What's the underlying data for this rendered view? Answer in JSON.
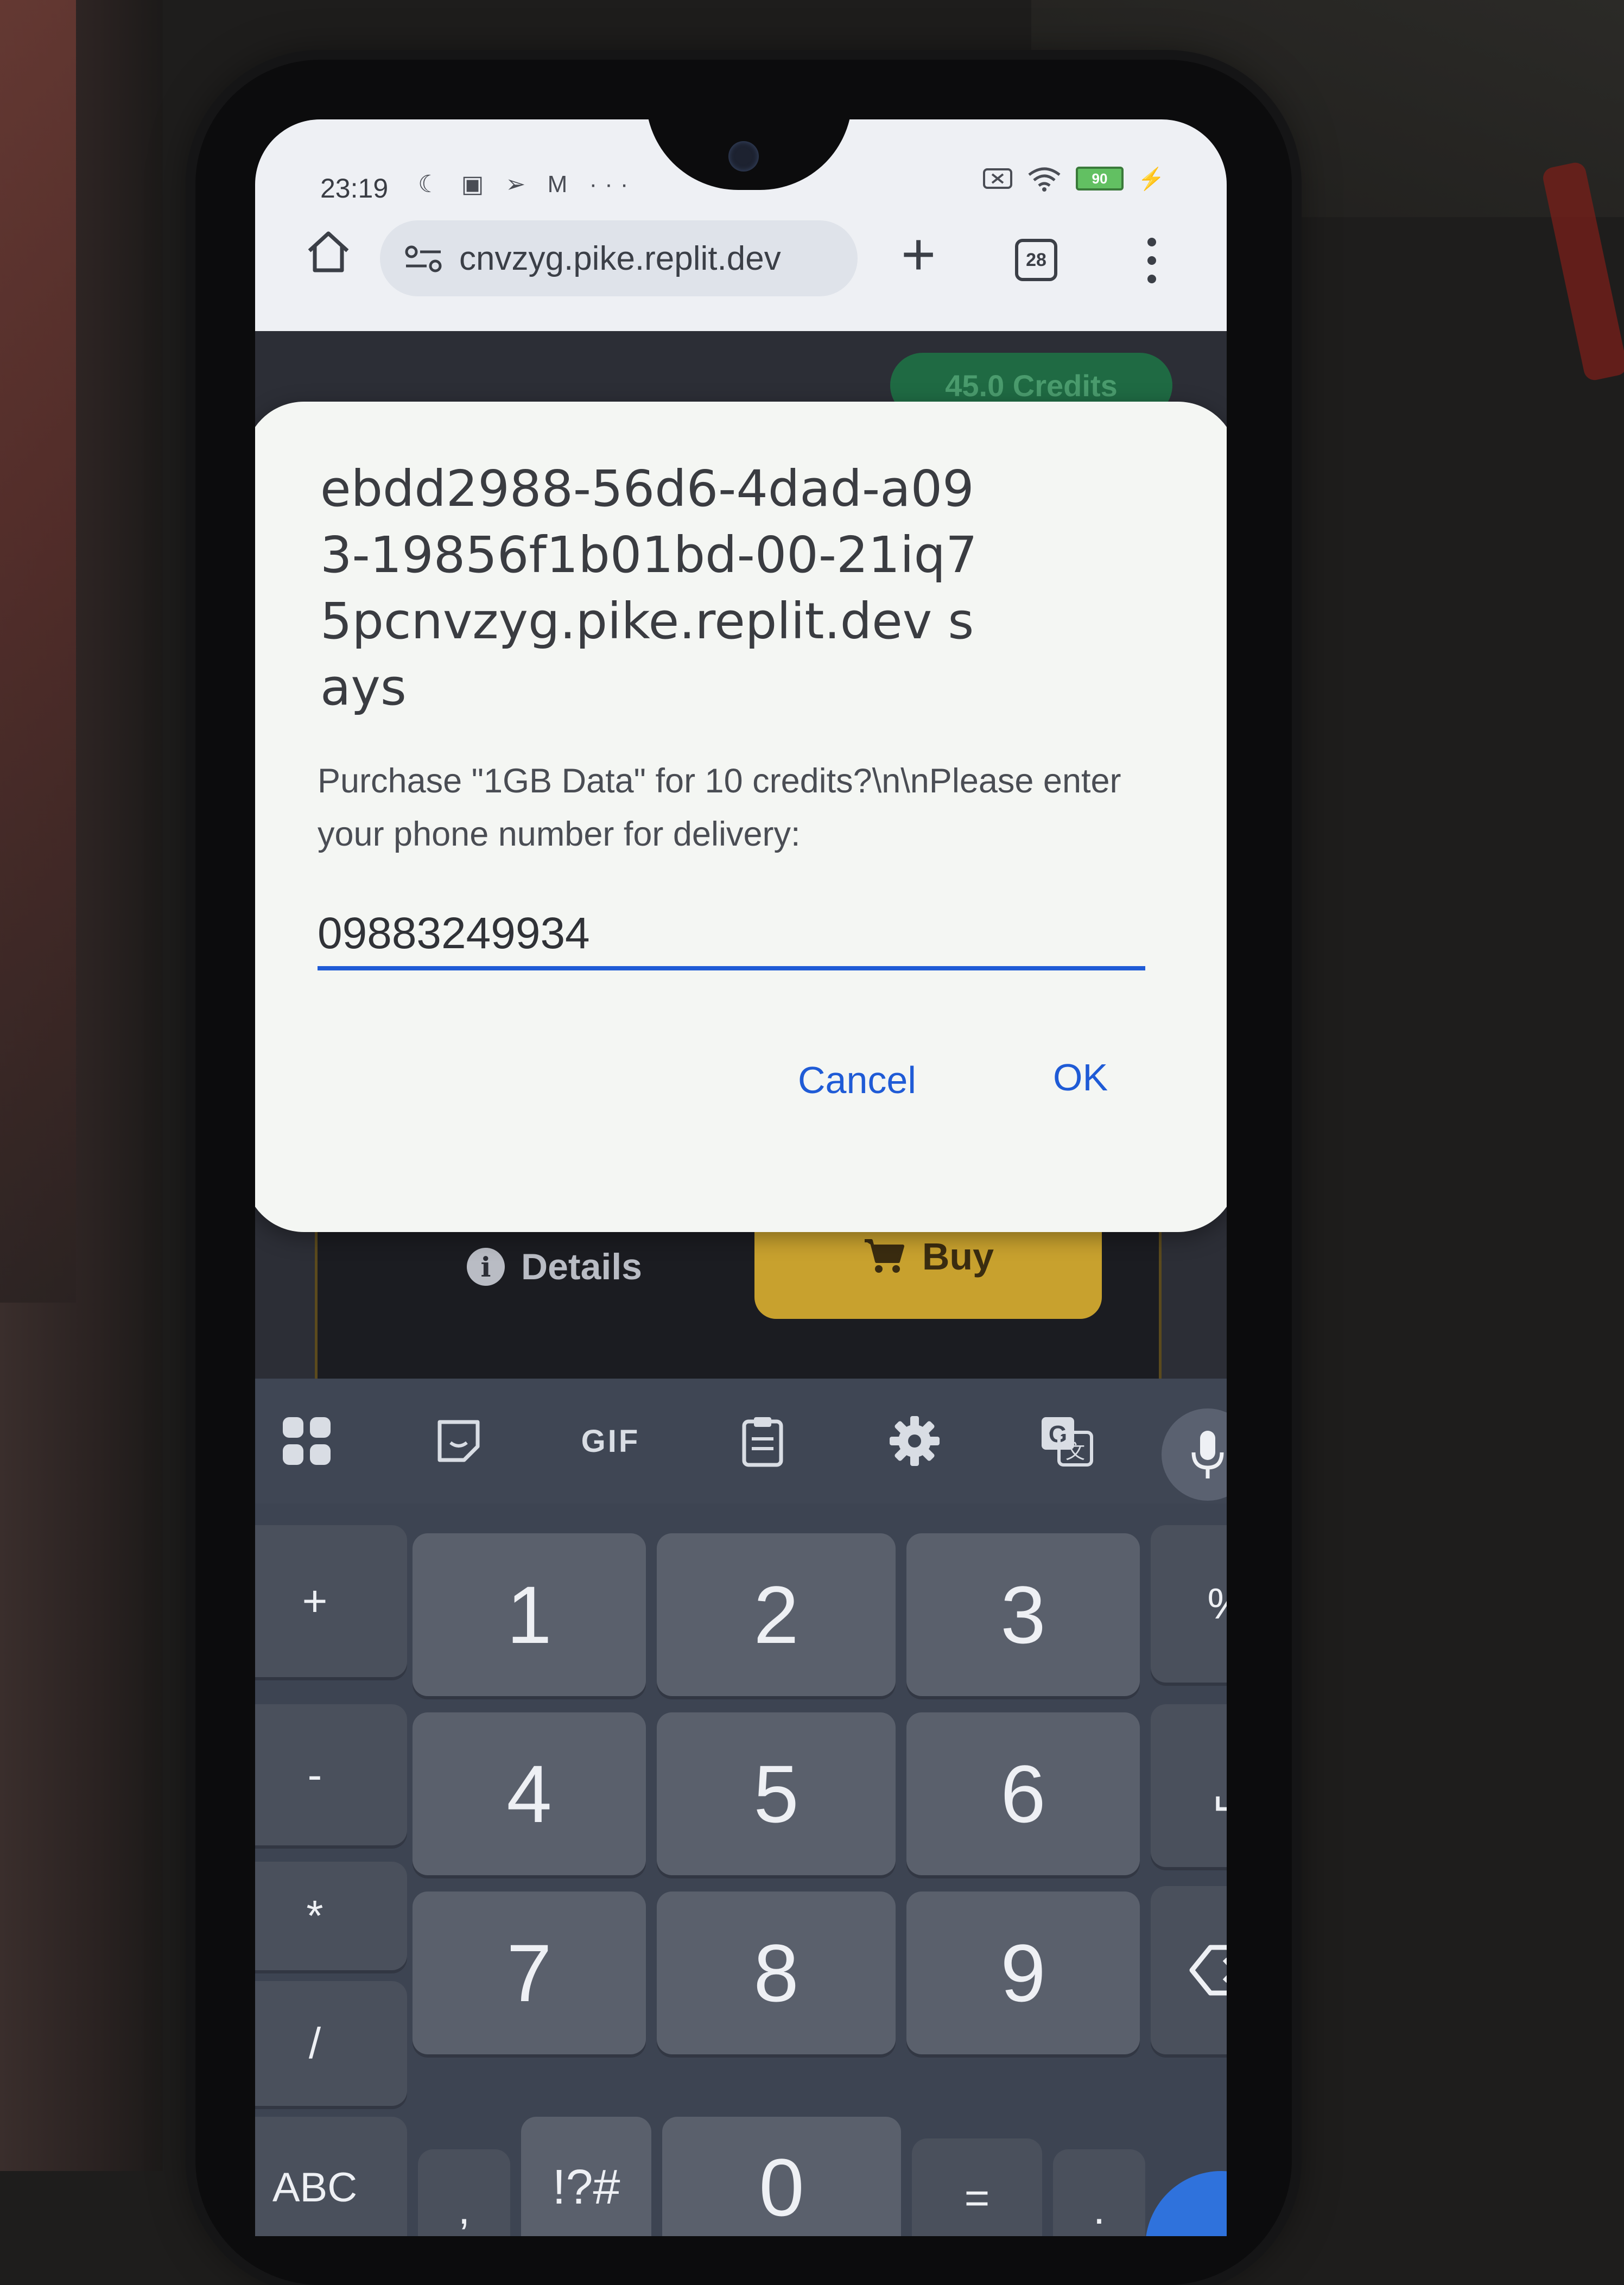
{
  "status_bar": {
    "time": "23:19",
    "battery": "90"
  },
  "browser": {
    "url": "cnvzyg.pike.replit.dev",
    "tab_count": "28"
  },
  "page": {
    "credits_label": "45.0 Credits",
    "details_label": "Details",
    "buy_label": "Buy",
    "accent_color": "#c8a12e"
  },
  "dialog": {
    "title": "ebdd2988-56d6-4dad-a093-19856f1b01bd-00-21iq75pcnvzyg.pike.replit.dev says",
    "message": "Purchase \"1GB Data\" for 10 credits?\\n\\nPlease enter your phone number for delivery:",
    "input_value": "09883249934",
    "cancel_label": "Cancel",
    "ok_label": "OK",
    "accent_color": "#1f5bd6"
  },
  "keyboard": {
    "toolbar": {
      "gif_label": "GIF"
    },
    "rows": [
      [
        "+",
        "1",
        "2",
        "3",
        "%"
      ],
      [
        "-",
        "4",
        "5",
        "6",
        "␣"
      ],
      [
        "*",
        "7",
        "8",
        "9",
        "⌫"
      ],
      [
        "/"
      ]
    ],
    "bottom_row": [
      "ABC",
      ",",
      "!?#",
      "0",
      "=",
      "."
    ]
  }
}
